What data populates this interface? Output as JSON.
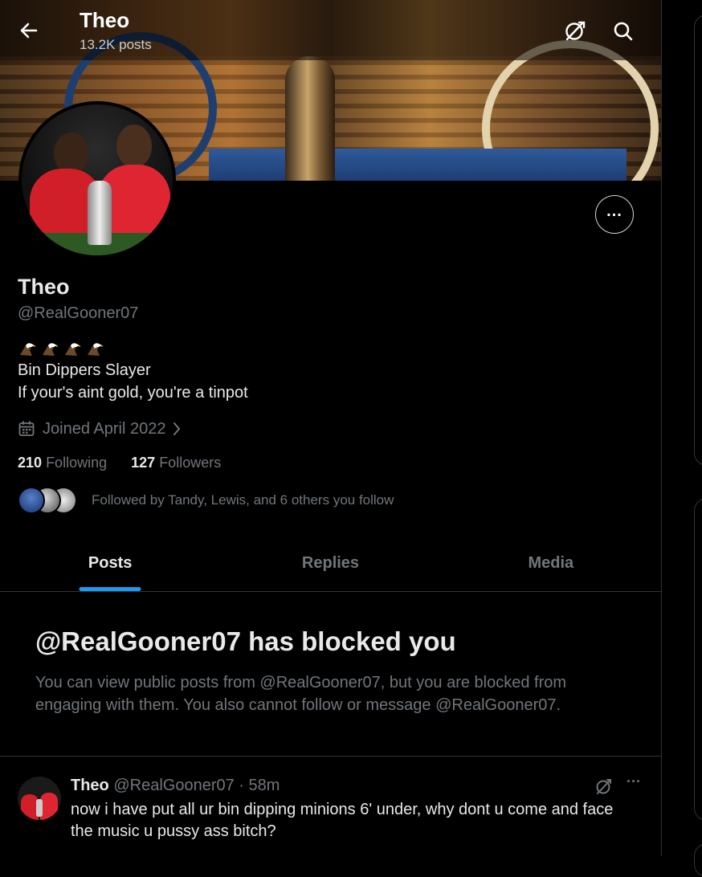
{
  "header": {
    "title": "Theo",
    "post_count": "13.2K posts"
  },
  "profile": {
    "display_name": "Theo",
    "handle": "@RealGooner07",
    "bio_emoji": [
      "eagle",
      "eagle",
      "eagle",
      "eagle"
    ],
    "bio_lines": [
      "Bin Dippers Slayer",
      "If your's aint gold, you're a tinpot"
    ],
    "joined": "Joined April 2022",
    "following_count": "210",
    "following_label": "Following",
    "followers_count": "127",
    "followers_label": "Followers",
    "followed_by": "Followed by Tandy, Lewis, and 6 others you follow"
  },
  "tabs": [
    {
      "label": "Posts",
      "active": true
    },
    {
      "label": "Replies",
      "active": false
    },
    {
      "label": "Media",
      "active": false
    }
  ],
  "blocked_notice": {
    "title": "@RealGooner07 has blocked you",
    "description": "You can view public posts from @RealGooner07, but you are blocked from engaging with them. You also cannot follow or message @RealGooner07."
  },
  "post": {
    "author_name": "Theo",
    "meta": "@RealGooner07 · 58m",
    "text": "now i have put all ur bin dipping minions 6' under, why dont u come and face the music u pussy ass bitch?"
  },
  "colors": {
    "accent": "#1d9bf0",
    "text_primary": "#e7e9ea",
    "text_secondary": "#71767b",
    "border": "#2f3336",
    "background": "#000000"
  },
  "icons": {
    "back": "arrow-left-icon",
    "grok": "grok-icon",
    "search": "search-icon",
    "more": "more-horizontal-icon",
    "calendar": "calendar-icon",
    "chevron": "chevron-right-icon"
  }
}
